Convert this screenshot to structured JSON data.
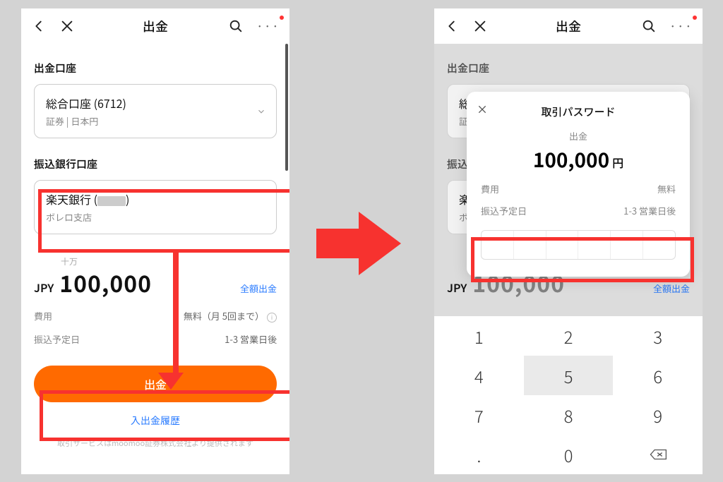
{
  "header": {
    "title": "出金"
  },
  "left": {
    "account_section": "出金口座",
    "account_line1": "総合口座 (6712)",
    "account_line2": "証券 | 日本円",
    "bank_section": "振込銀行口座",
    "bank_line1_prefix": "楽天銀行 (",
    "bank_line1_suffix": ")",
    "bank_line2": "ボレロ支店",
    "amount_hint": "十万",
    "currency": "JPY",
    "amount": "100,000",
    "full_withdraw": "全額出金",
    "fee_label": "費用",
    "fee_value": "無料（月 5回まで）",
    "eta_label": "振込予定日",
    "eta_value": "1-3 営業日後",
    "submit": "出金",
    "history": "入出金履歴",
    "footnote": "取引サービスはmoomoo証券株式会社より提供されます"
  },
  "right": {
    "modal_title": "取引パスワード",
    "modal_sub": "出金",
    "modal_amount": "100,000",
    "modal_unit": "円",
    "modal_fee_label": "費用",
    "modal_fee_value": "無料",
    "modal_eta_label": "振込予定日",
    "modal_eta_value": "1-3 営業日後",
    "keypad": [
      "1",
      "2",
      "3",
      "4",
      "5",
      "6",
      "7",
      "8",
      "9",
      ".",
      "0",
      ""
    ]
  }
}
